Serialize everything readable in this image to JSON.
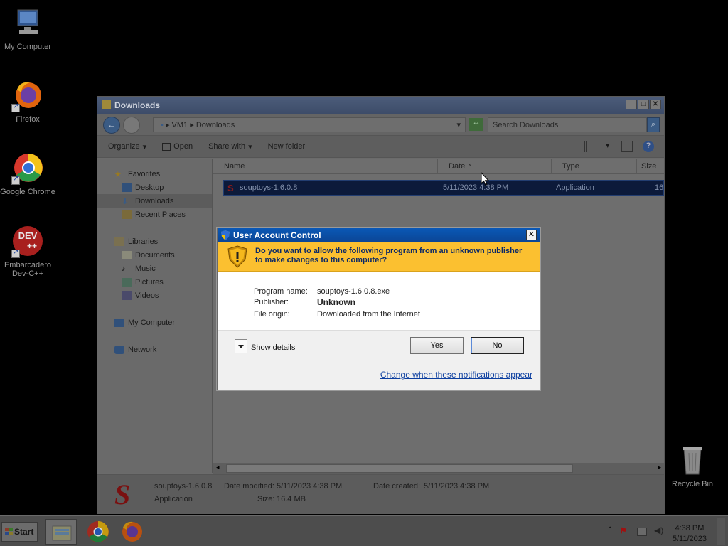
{
  "desktop": {
    "icons": [
      {
        "label": "My Computer"
      },
      {
        "label": "Firefox"
      },
      {
        "label": "Google Chrome"
      },
      {
        "label": "Embarcadero Dev-C++"
      },
      {
        "label": "Recycle Bin"
      }
    ]
  },
  "explorer": {
    "title": "Downloads",
    "address": {
      "crumbs": [
        "VM1",
        "Downloads"
      ]
    },
    "search_placeholder": "Search Downloads",
    "toolbar": {
      "organize": "Organize",
      "open": "Open",
      "share_with": "Share with",
      "new_folder": "New folder"
    },
    "nav": {
      "favorites": "Favorites",
      "desktop": "Desktop",
      "downloads": "Downloads",
      "recent_places": "Recent Places",
      "libraries": "Libraries",
      "documents": "Documents",
      "music": "Music",
      "pictures": "Pictures",
      "videos": "Videos",
      "my_computer": "My Computer",
      "network": "Network"
    },
    "columns": {
      "name": "Name",
      "date": "Date",
      "type": "Type",
      "size": "Size"
    },
    "file": {
      "name": "souptoys-1.6.0.8",
      "date": "5/11/2023 4:38 PM",
      "type": "Application",
      "size_trunc": "16"
    },
    "details": {
      "name": "souptoys-1.6.0.8",
      "type": "Application",
      "modified_label": "Date modified:",
      "modified": "5/11/2023 4:38 PM",
      "created_label": "Date created:",
      "created": "5/11/2023 4:38 PM",
      "size_label": "Size:",
      "size": "16.4 MB"
    }
  },
  "uac": {
    "title": "User Account Control",
    "question": "Do you want to allow the following program from an unknown publisher to make changes to this computer?",
    "program_name_label": "Program name:",
    "program_name": "souptoys-1.6.0.8.exe",
    "publisher_label": "Publisher:",
    "publisher": "Unknown",
    "file_origin_label": "File origin:",
    "file_origin": "Downloaded from the Internet",
    "show_details": "Show details",
    "yes": "Yes",
    "no": "No",
    "change_link": "Change when these notifications appear"
  },
  "taskbar": {
    "start": "Start",
    "clock_time": "4:38 PM",
    "clock_date": "5/11/2023"
  }
}
